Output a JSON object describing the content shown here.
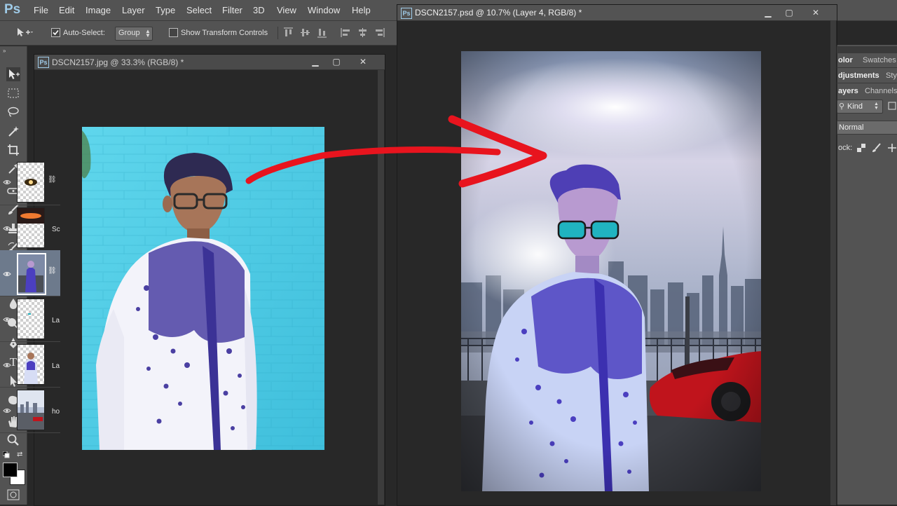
{
  "app": {
    "logo": "Ps"
  },
  "menu": [
    "File",
    "Edit",
    "Image",
    "Layer",
    "Type",
    "Select",
    "Filter",
    "3D",
    "View",
    "Window",
    "Help"
  ],
  "options": {
    "auto_select_label": "Auto-Select:",
    "auto_select_checked": true,
    "group_value": "Group",
    "show_transform_label": "Show Transform Controls",
    "show_transform_checked": false
  },
  "doc_left": {
    "badge": "Ps",
    "title": "DSCN2157.jpg @ 33.3% (RGB/8) *"
  },
  "doc_right": {
    "badge": "Ps",
    "title": "DSCN2157.psd @ 10.7% (Layer 4, RGB/8) *"
  },
  "panel": {
    "tabs_row1": [
      "olor",
      "Swatches"
    ],
    "tabs_row2": [
      "djustments",
      "Sty"
    ],
    "tabs_row3": [
      "ayers",
      "Channels"
    ],
    "kind_label": "Kind",
    "blend_mode": "Normal",
    "lock_label": "ock:",
    "layers": [
      {
        "name": ""
      },
      {
        "name": "Sc"
      },
      {
        "name": ""
      },
      {
        "name": "La"
      },
      {
        "name": "La"
      },
      {
        "name": "ho"
      }
    ]
  },
  "colors": {
    "accent_red": "#e8141e",
    "ps_blue": "#9fcbe8",
    "ui_gray": "#535353"
  },
  "icons": {
    "tools": [
      "move-icon",
      "marquee-icon",
      "lasso-icon",
      "magic-wand-icon",
      "crop-icon",
      "eyedropper-icon",
      "healing-icon",
      "brush-icon",
      "stamp-icon",
      "history-brush-icon",
      "eraser-icon",
      "gradient-icon",
      "blur-icon",
      "dodge-icon",
      "pen-icon",
      "type-icon",
      "path-select-icon",
      "shape-icon",
      "hand-icon",
      "zoom-icon"
    ]
  }
}
